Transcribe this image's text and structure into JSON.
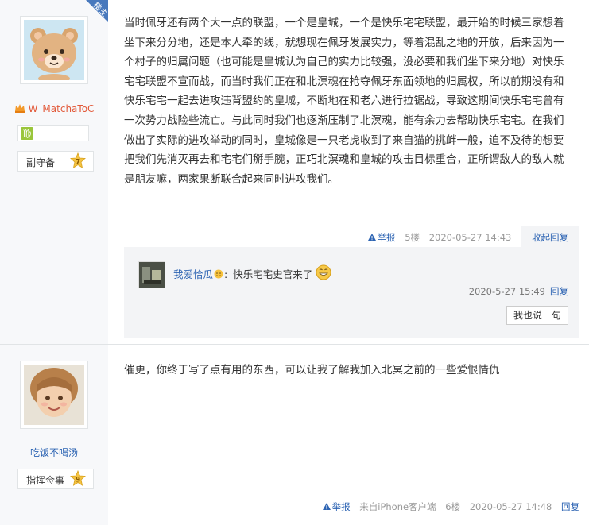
{
  "posts": [
    {
      "author": {
        "name": "W_MatchaToC",
        "badge": "楼主",
        "rank_title": "副守备",
        "level": "7",
        "zodiac": "♍",
        "avatar_icon": "bear-avatar",
        "vip_icon": "crown-icon"
      },
      "content": "当时佩牙还有两个大一点的联盟，一个是皇城，一个是快乐宅宅联盟，最开始的时候三家想着坐下来分分地，还是本人牵的线，就想现在佩牙发展实力，等着混乱之地的开放，后来因为一个村子的归属问题（也可能是皇城认为自己的实力比较强，没必要和我们坐下来分地）对快乐宅宅联盟不宣而战，而当时我们正在和北溟魂在抢夺佩牙东面领地的归属权，所以前期没有和快乐宅宅一起去进攻违背盟约的皇城，不断地在和老六进行拉锯战，导致这期间快乐宅宅曾有一次势力战险些流亡。与此同时我们也逐渐压制了北溟魂，能有余力去帮助快乐宅宅。在我们做出了实际的进攻举动的同时，皇城像是一只老虎收到了来自猫的挑衅一般，迫不及待的想要把我们先消灭再去和宅宅们掰手腕，正巧北溟魂和皇城的攻击目标重合，正所谓敌人的敌人就是朋友嘛，两家果断联合起来同时进攻我们。",
      "tail": {
        "report": "举报",
        "floor": "5楼",
        "time": "2020-05-27 14:43",
        "collapse": "收起回复"
      },
      "replies": [
        {
          "user": "我爱恰瓜",
          "separator": ":",
          "text": "快乐宅宅史官来了",
          "time": "2020-5-27 15:49",
          "reply": "回复"
        }
      ],
      "say_button": "我也说一句"
    },
    {
      "author": {
        "name": "吃饭不喝汤",
        "rank_title": "指挥佥事",
        "level": "9",
        "avatar_icon": "child-photo-avatar"
      },
      "content": "催更，你终于写了点有用的东西，可以让我了解我加入北冥之前的一些爱恨情仇",
      "tail": {
        "report": "举报",
        "client": "来自iPhone客户端",
        "floor": "6楼",
        "time": "2020-05-27 14:48",
        "reply": "回复"
      }
    }
  ],
  "colors": {
    "link": "#2d64b3",
    "sidebar_bg": "#f7f8fa",
    "badge_bg": "#4879bd",
    "level_star": "#f4c342"
  }
}
